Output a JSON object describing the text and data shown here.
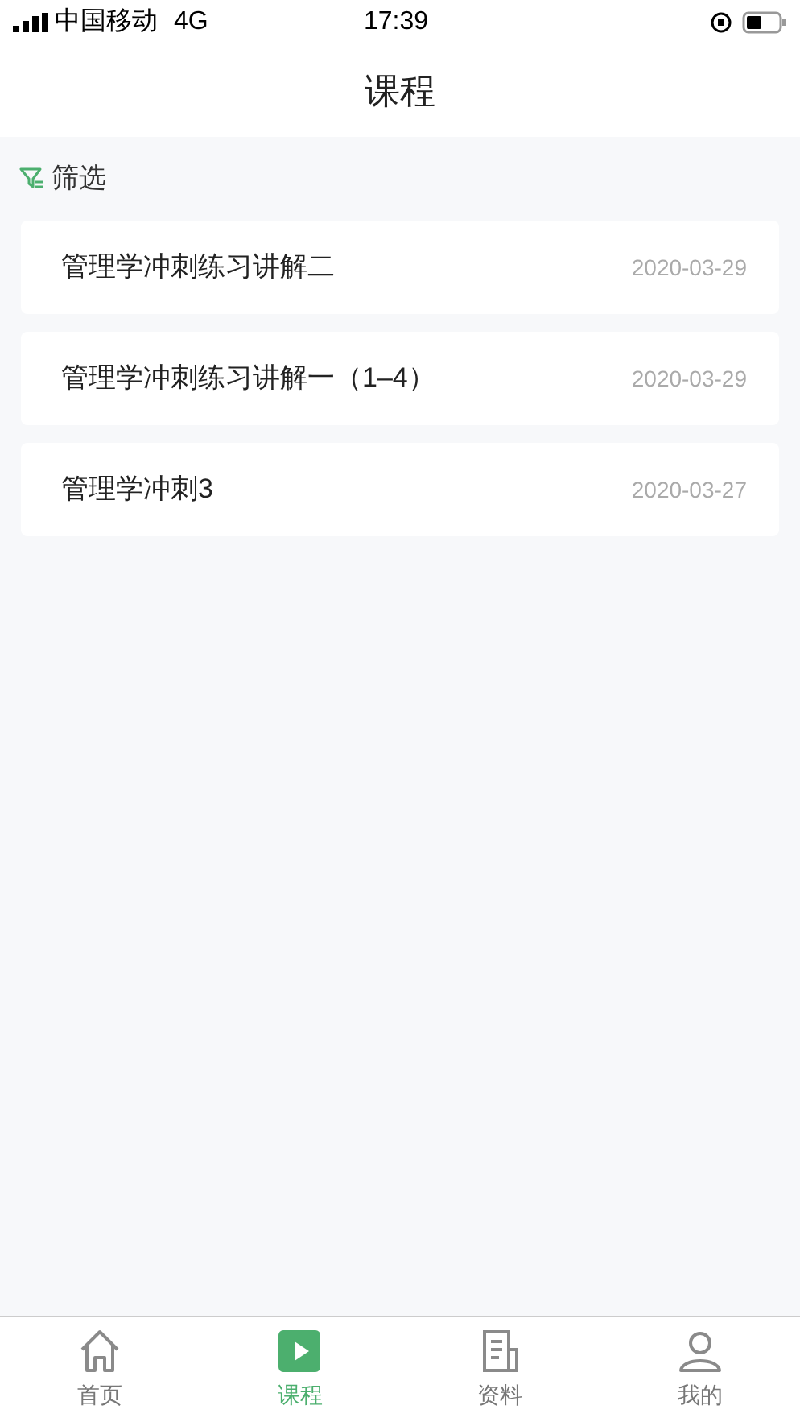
{
  "status_bar": {
    "carrier": "中国移动",
    "network": "4G",
    "time": "17:39"
  },
  "header": {
    "title": "课程"
  },
  "filter": {
    "label": "筛选"
  },
  "courses": [
    {
      "title": "管理学冲刺练习讲解二",
      "date": "2020-03-29"
    },
    {
      "title": "管理学冲刺练习讲解一（1–4）",
      "date": "2020-03-29"
    },
    {
      "title": "管理学冲刺3",
      "date": "2020-03-27"
    }
  ],
  "tabs": [
    {
      "kind": "home",
      "label": "首页",
      "selected": false
    },
    {
      "kind": "play",
      "label": "课程",
      "selected": true
    },
    {
      "kind": "docs",
      "label": "资料",
      "selected": false
    },
    {
      "kind": "profile",
      "label": "我的",
      "selected": false
    }
  ]
}
